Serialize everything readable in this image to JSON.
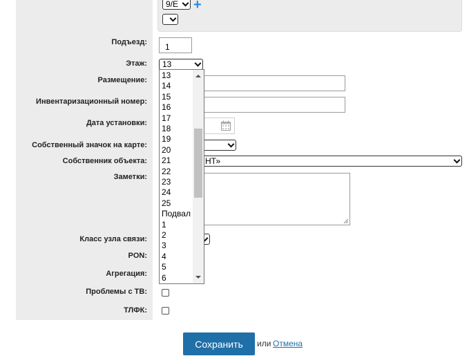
{
  "top_panel": {
    "building_select_value": "9/Е",
    "second_select_value": ""
  },
  "form": {
    "entrance": {
      "label": "Подъезд:",
      "value": "1"
    },
    "floor": {
      "label": "Этаж:",
      "value": "13"
    },
    "placement": {
      "label": "Размещение:"
    },
    "inventory_number": {
      "label": "Инвентаризационный номер:"
    },
    "install_date": {
      "label": "Дата установки:"
    },
    "map_icon": {
      "label": "Собственный значок на карте:"
    },
    "owner": {
      "label": "Собственник объекта:",
      "value_visible": "НТ»"
    },
    "notes": {
      "label": "Заметки:"
    },
    "node_class": {
      "label": "Класс узла связи:"
    },
    "pon": {
      "label": "PON:"
    },
    "aggregation": {
      "label": "Агрегация:"
    },
    "tv_problems": {
      "label": "Проблемы с ТВ:"
    },
    "tlfk": {
      "label": "ТЛФК:"
    }
  },
  "floor_dropdown": {
    "options": [
      "13",
      "14",
      "15",
      "16",
      "17",
      "18",
      "19",
      "20",
      "21",
      "22",
      "23",
      "24",
      "25",
      "Подвал",
      "1",
      "2",
      "3",
      "4",
      "5",
      "6"
    ]
  },
  "actions": {
    "save_label": "Сохранить",
    "or_text": "или",
    "cancel_label": "Отмена"
  },
  "colors": {
    "primary": "#1f6fa8",
    "panel_bg": "#ececec",
    "plus_icon": "#2a8be0"
  }
}
